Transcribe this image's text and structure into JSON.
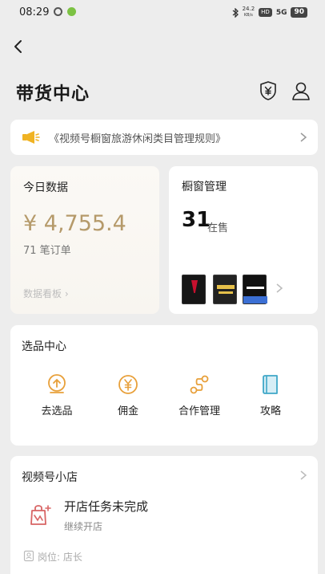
{
  "status_bar": {
    "time": "08:29",
    "net_speed": "24.2",
    "net_unit": "KB/s",
    "hd_badge": "HD",
    "signal": "5G",
    "battery": "90"
  },
  "header": {
    "title": "带货中心",
    "icons": [
      "back-arrow-icon",
      "shield-yen-icon",
      "user-icon"
    ]
  },
  "notice": {
    "text": "《视频号橱窗旅游休闲类目管理规则》",
    "icon": "megaphone-icon"
  },
  "today_data": {
    "title": "今日数据",
    "amount": "¥ 4,755.4",
    "orders": "71 笔订单",
    "board_link": "数据看板"
  },
  "window_mgmt": {
    "title": "橱窗管理",
    "count": "31",
    "count_label": "在售"
  },
  "selection_center": {
    "title": "选品中心",
    "items": [
      {
        "label": "去选品",
        "icon": "pick-product-icon"
      },
      {
        "label": "佣金",
        "icon": "yen-coin-icon"
      },
      {
        "label": "合作管理",
        "icon": "route-icon"
      },
      {
        "label": "攻略",
        "icon": "book-icon"
      }
    ]
  },
  "shop": {
    "title": "视频号小店",
    "task_title": "开店任务未完成",
    "task_sub": "继续开店",
    "role": "岗位: 店长"
  },
  "colors": {
    "accent_gold": "#b59a6a",
    "icon_orange": "#e8a03a",
    "icon_teal": "#3fa7c8",
    "background": "#ededed"
  }
}
